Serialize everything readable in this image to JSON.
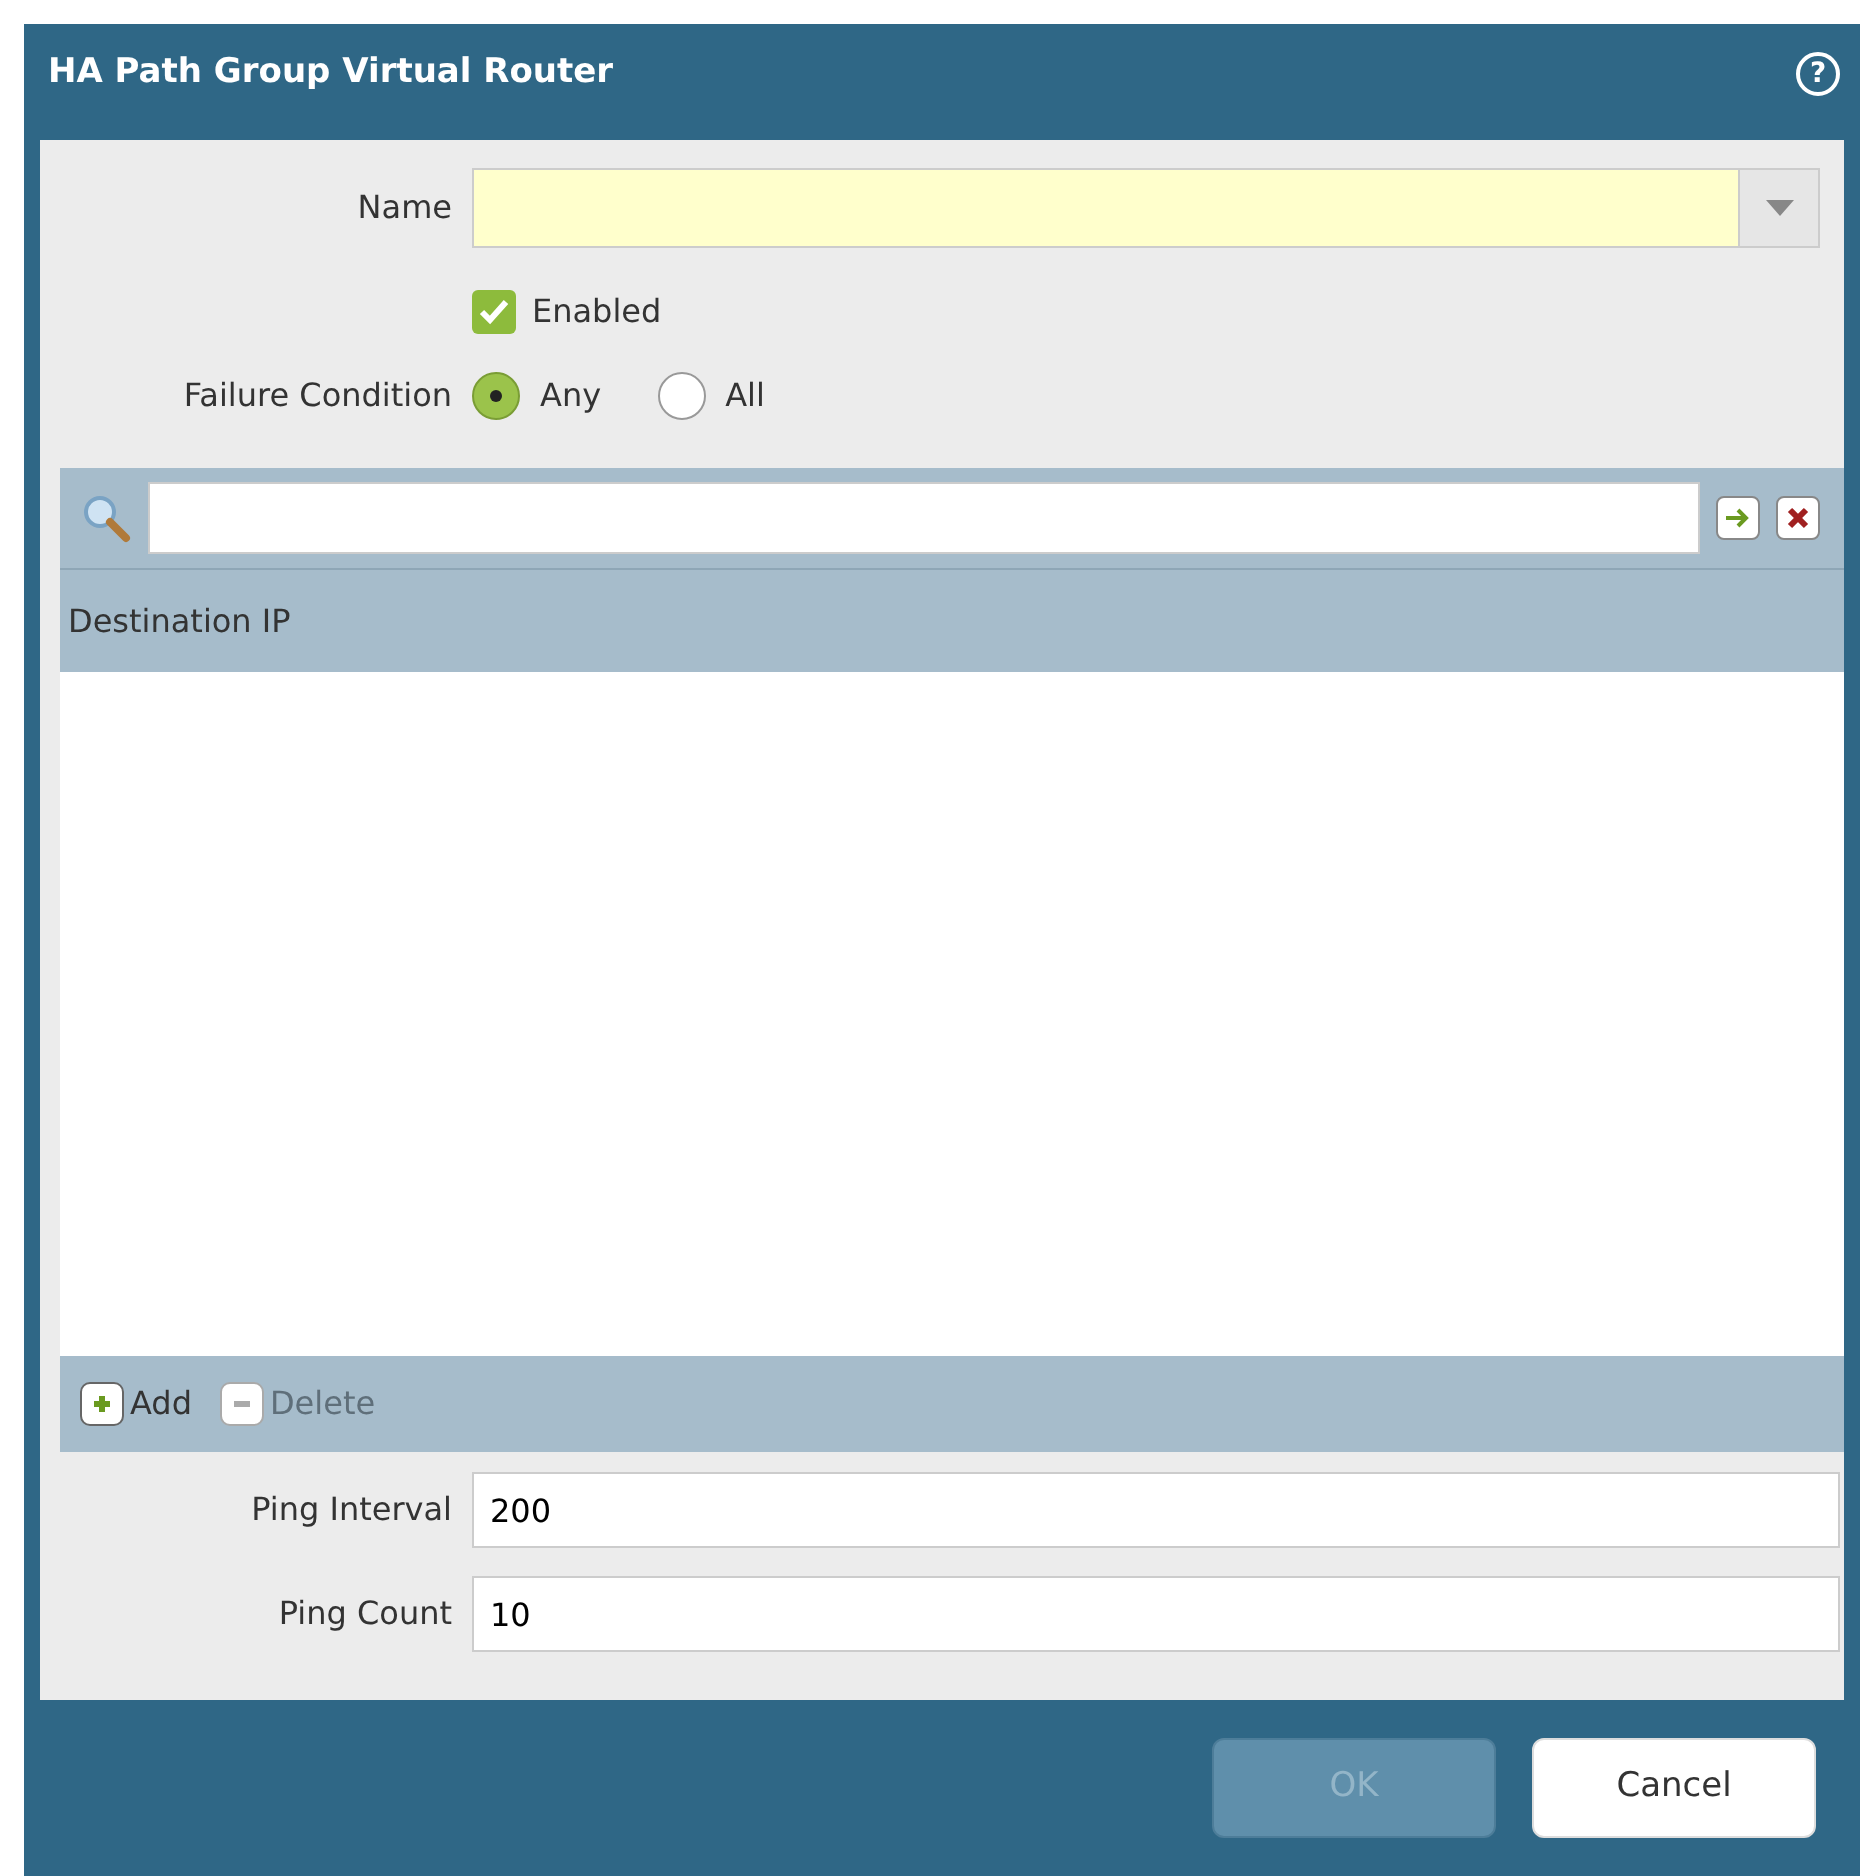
{
  "window": {
    "title": "HA Path Group Virtual Router",
    "help": "?"
  },
  "name_field": {
    "label": "Name"
  },
  "enabled": {
    "label": "Enabled",
    "checked": true
  },
  "failure_condition": {
    "label": "Failure Condition",
    "options": [
      {
        "label": "Any",
        "selected": true
      },
      {
        "label": "All",
        "selected": false
      }
    ]
  },
  "grid": {
    "columns": [
      "Destination IP"
    ],
    "actions": [
      {
        "label": "Add",
        "kind": "add",
        "disabled": false
      },
      {
        "label": "Delete",
        "kind": "delete",
        "disabled": true
      }
    ]
  },
  "ping_interval": {
    "label": "Ping Interval",
    "value": "200"
  },
  "ping_count": {
    "label": "Ping Count",
    "value": "10"
  },
  "buttons": [
    {
      "label": "OK",
      "disabled": true
    },
    {
      "label": "Cancel",
      "disabled": false
    }
  ]
}
